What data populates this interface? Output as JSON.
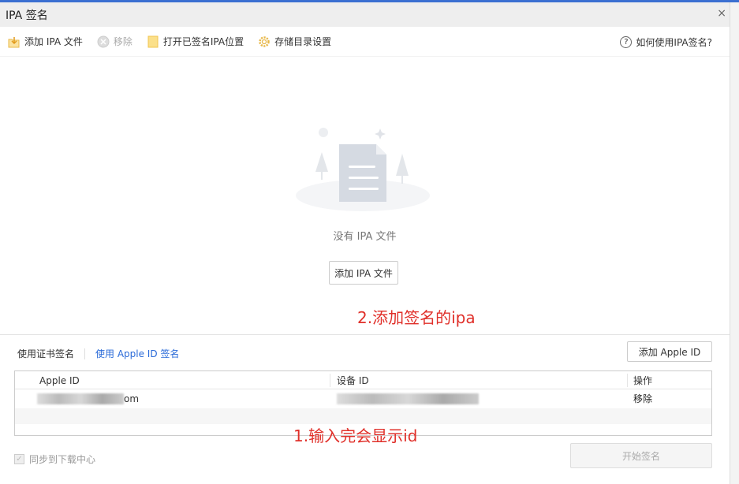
{
  "window": {
    "title": "IPA 签名",
    "close": "×"
  },
  "toolbar": {
    "add_ipa": "添加 IPA 文件",
    "remove": "移除",
    "open_signed": "打开已签名IPA位置",
    "storage_settings": "存储目录设置",
    "help": "如何使用IPA签名?"
  },
  "empty": {
    "text": "没有 IPA 文件",
    "add_button": "添加 IPA 文件"
  },
  "annotations": {
    "step2": "2.添加签名的ipa",
    "step1": "1.输入完会显示id"
  },
  "tabs": {
    "cert": "使用证书签名",
    "apple_id": "使用 Apple ID 签名"
  },
  "add_apple_id": "添加 Apple ID",
  "table": {
    "headers": [
      "Apple ID",
      "设备 ID",
      "操作"
    ],
    "rows": [
      {
        "apple_id_visible": "om",
        "action": "移除"
      }
    ]
  },
  "sync": {
    "label": "同步到下载中心",
    "checked": true
  },
  "start_button": "开始签名",
  "colors": {
    "annotation": "#e0302a",
    "link": "#2a6ad8"
  }
}
